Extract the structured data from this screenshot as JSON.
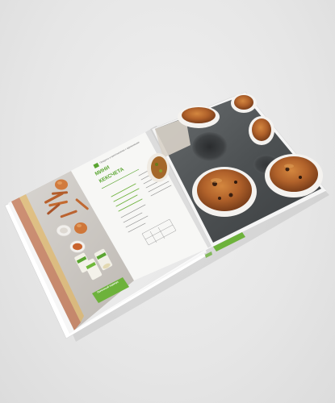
{
  "photo": {
    "subject": "open-cookbook-on-table",
    "left_page": {
      "heading_line_1": "МИНИ",
      "heading_line_2": "КЕКСЧЕТА",
      "header_note": "Продукты и приготовления с одинаковыми"
    }
  },
  "colors": {
    "background": "#e6e6e6",
    "accent_green": "#5aa531",
    "tray": "#4a4d4f",
    "muffin": "#b7652a"
  }
}
